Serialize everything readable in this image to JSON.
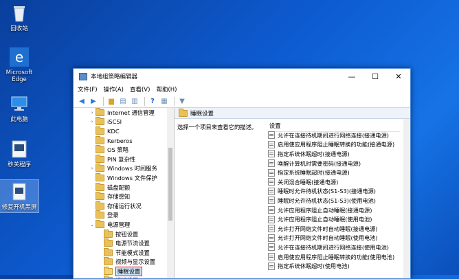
{
  "desktop": {
    "icons": [
      {
        "label": "回收站"
      },
      {
        "label": "Microsoft Edge"
      },
      {
        "label": "此电脑"
      },
      {
        "label": "秒关程序"
      },
      {
        "label": "修复开机黑屏"
      }
    ]
  },
  "window": {
    "title": "本地组策略编辑器",
    "menu": [
      "文件(F)",
      "操作(A)",
      "查看(V)",
      "帮助(H)"
    ],
    "controls": {
      "minimize": "—",
      "maximize": "☐",
      "close": "✕"
    }
  },
  "tree": {
    "items": [
      {
        "label": "Internet 通信管理",
        "caret": "›"
      },
      {
        "label": "iSCSI",
        "caret": "›"
      },
      {
        "label": "KDC",
        "caret": ""
      },
      {
        "label": "Kerberos",
        "caret": ""
      },
      {
        "label": "OS 策略",
        "caret": ""
      },
      {
        "label": "PIN 复杂性",
        "caret": ""
      },
      {
        "label": "Windows 时间服务",
        "caret": "›"
      },
      {
        "label": "Windows 文件保护",
        "caret": ""
      },
      {
        "label": "磁盘配额",
        "caret": ""
      },
      {
        "label": "存储感知",
        "caret": ""
      },
      {
        "label": "存储运行状况",
        "caret": ""
      },
      {
        "label": "登录",
        "caret": ""
      },
      {
        "label": "电源管理",
        "caret": "⌄"
      },
      {
        "label": "按钮设置",
        "caret": ""
      },
      {
        "label": "电源节流设置",
        "caret": ""
      },
      {
        "label": "节能模式设置",
        "caret": ""
      },
      {
        "label": "视频与显示设置",
        "caret": ""
      },
      {
        "label": "睡眠设置",
        "caret": ""
      },
      {
        "label": "通知设置",
        "caret": ""
      }
    ]
  },
  "detail": {
    "header": "睡眠设置",
    "description": "选择一个项目来查看它的描述。",
    "column": "设置",
    "settings": [
      "允许在连接待机期间进行网络连接(接通电源)",
      "启用使应用程序阻止睡眠转换的功能(接通电源)",
      "指定系统休眠超时(接通电源)",
      "唤醒计算机时需要密码(接通电源)",
      "指定系统睡眠超时(接通电源)",
      "关闭混合睡眠(接通电源)",
      "睡眠时允许待机状态(S1-S3)(接通电源)",
      "睡眠时允许待机状态(S1-S3)(使用电池)",
      "允许应用程序阻止自动睡眠(接通电源)",
      "允许应用程序阻止自动睡眠(使用电池)",
      "允许打开网络文件时自动睡眠(接通电源)",
      "允许打开网络文件时自动睡眠(使用电池)",
      "允许在连接待机期间进行网络连接(使用电池)",
      "启用使应用程序阻止睡眠转换的功能(使用电池)",
      "指定系统休眠超时(使用电池)"
    ]
  }
}
